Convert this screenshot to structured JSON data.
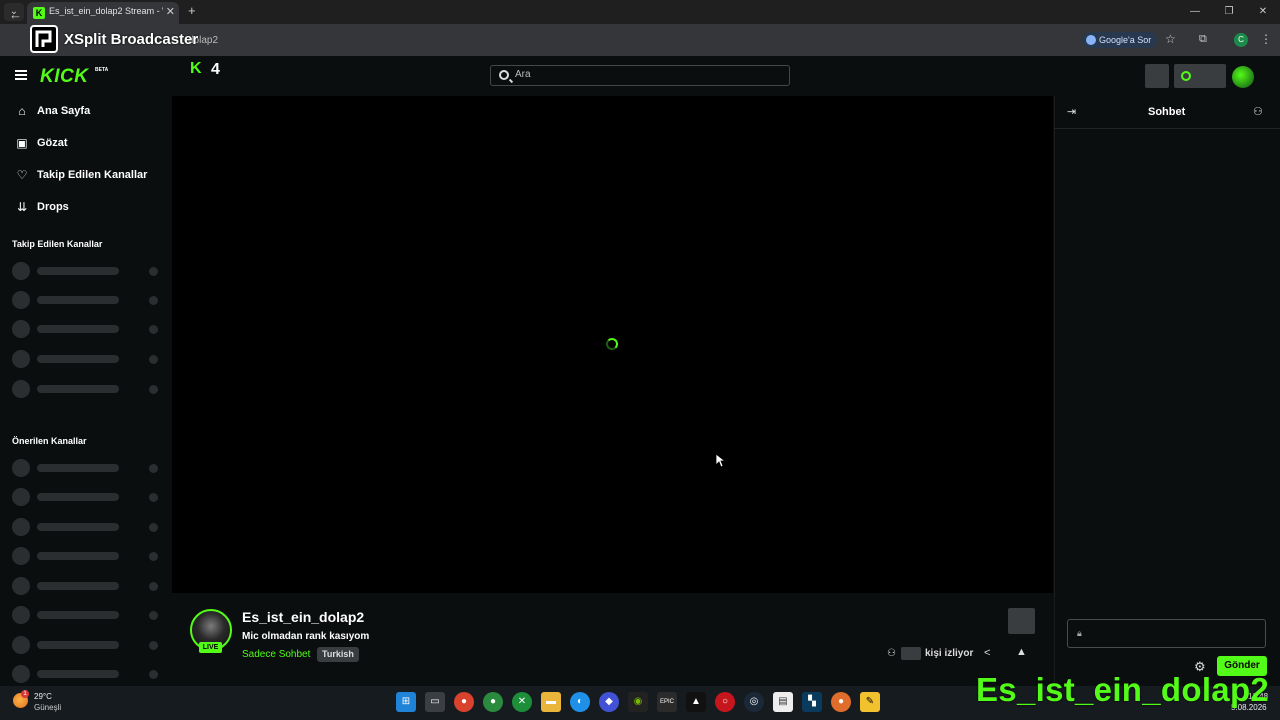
{
  "browser": {
    "tab_title": "Es_ist_ein_dolap2 Stream - Watc",
    "url_fragment": "dolap2",
    "google_label": "Google'a Sor",
    "profile_initial": "C"
  },
  "overlay": {
    "app_name": "XSplit Broadcaster",
    "channel_name": "Es_ist_ein_dolap2"
  },
  "header": {
    "logo": "KICK",
    "logo_beta": "BETA",
    "k4_label": "4",
    "search_placeholder": "Ara"
  },
  "sidebar": {
    "nav": [
      {
        "label": "Ana Sayfa",
        "icon": "home-icon"
      },
      {
        "label": "Gözat",
        "icon": "browse-icon"
      },
      {
        "label": "Takip Edilen Kanallar",
        "icon": "heart-icon"
      },
      {
        "label": "Drops",
        "icon": "drops-icon"
      }
    ],
    "followed_heading": "Takip Edilen Kanallar",
    "suggested_heading": "Önerilen Kanallar"
  },
  "stream": {
    "channel": "Es_ist_ein_dolap2",
    "title": "Mic olmadan rank kasıyom",
    "category": "Sadece Sohbet",
    "tag": "Turkish",
    "live_badge": "LIVE",
    "viewers_label": "kişi izliyor"
  },
  "chat": {
    "title": "Sohbet",
    "send_label": "Gönder"
  },
  "taskbar": {
    "temperature": "29°C",
    "weather": "Güneşli",
    "weather_badge": "1",
    "time": "13:48",
    "date": "5.08.2026"
  },
  "colors": {
    "kick_green": "#53fc18",
    "background": "#0b0e0f",
    "skeleton": "#2b2e31"
  }
}
